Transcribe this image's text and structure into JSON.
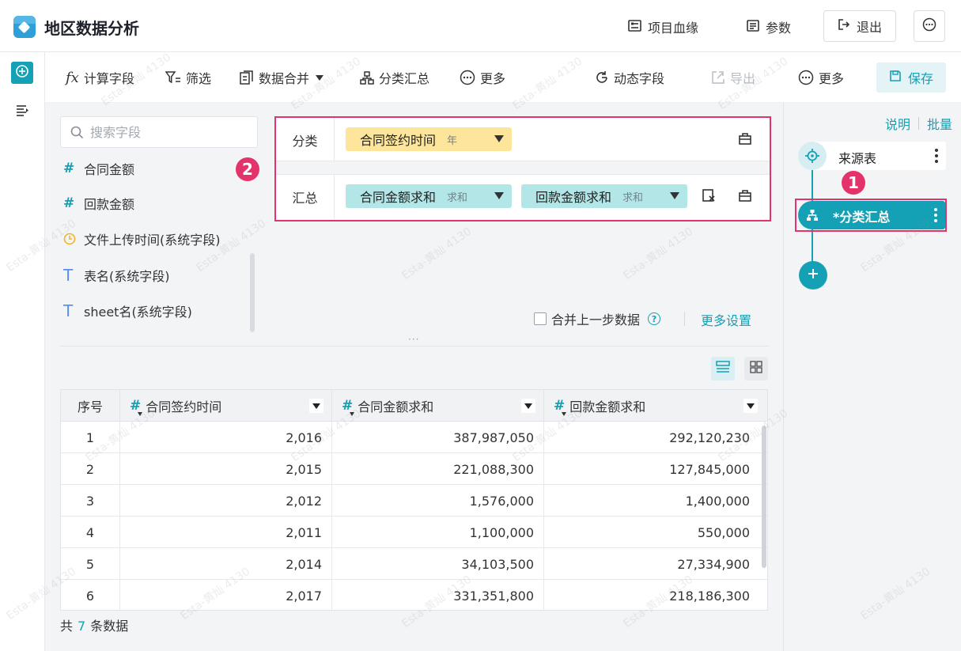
{
  "header": {
    "title": "地区数据分析",
    "buttons": {
      "lineage": "项目血缘",
      "params": "参数",
      "exit": "退出"
    }
  },
  "toolbar": {
    "calc_field": "计算字段",
    "filter": "筛选",
    "merge": "数据合并",
    "group_summary": "分类汇总",
    "more1": "更多",
    "dynamic_field": "动态字段",
    "export": "导出",
    "more2": "更多",
    "save": "保存"
  },
  "field_list": {
    "search_placeholder": "搜索字段",
    "fields": [
      {
        "name": "合同金额",
        "type": "number"
      },
      {
        "name": "回款金额",
        "type": "number"
      },
      {
        "name": "文件上传时间(系统字段)",
        "type": "date"
      },
      {
        "name": "表名(系统字段)",
        "type": "text"
      },
      {
        "name": "sheet名(系统字段)",
        "type": "text"
      }
    ]
  },
  "config": {
    "group_label": "分类",
    "group_chip": {
      "name": "合同签约时间",
      "sub": "年"
    },
    "summary_label": "汇总",
    "summary_chips": [
      {
        "name": "合同金额求和",
        "sub": "求和"
      },
      {
        "name": "回款金额求和",
        "sub": "求和"
      }
    ]
  },
  "badges": {
    "b1": "1",
    "b2": "2"
  },
  "options": {
    "merge_prev": "合并上一步数据",
    "help": "?",
    "more_settings": "更多设置",
    "grip": "···"
  },
  "table": {
    "columns": [
      "序号",
      "合同签约时间",
      "合同金额求和",
      "回款金额求和"
    ],
    "rows": [
      [
        "1",
        "2,016",
        "387,987,050",
        "292,120,230"
      ],
      [
        "2",
        "2,015",
        "221,088,300",
        "127,845,000"
      ],
      [
        "3",
        "2,012",
        "1,576,000",
        "1,400,000"
      ],
      [
        "4",
        "2,011",
        "1,100,000",
        "550,000"
      ],
      [
        "5",
        "2,014",
        "34,103,500",
        "27,334,900"
      ],
      [
        "6",
        "2,017",
        "331,351,800",
        "218,186,300"
      ]
    ],
    "total_prefix": "共",
    "total_count": "7",
    "total_suffix": "条数据"
  },
  "right_panel": {
    "explain": "说明",
    "batch": "批量",
    "source_node": "来源表",
    "summary_node": "*分类汇总"
  },
  "watermark": "Esta-黄灿 4130",
  "colors": {
    "accent": "#14a0b5",
    "highlight": "#e4336b",
    "chip_yellow": "#fde69b",
    "chip_teal": "#b3e6e6"
  },
  "icons": {
    "logo": "app-logo-icon",
    "lineage": "lineage-icon",
    "params": "params-icon",
    "exit": "exit-icon",
    "more": "ellipsis-circle-icon",
    "calc": "fx-icon",
    "filter": "filter-icon",
    "merge": "merge-icon",
    "group": "hierarchy-icon",
    "dynamic": "refresh-icon",
    "export": "export-icon",
    "save": "save-icon"
  }
}
